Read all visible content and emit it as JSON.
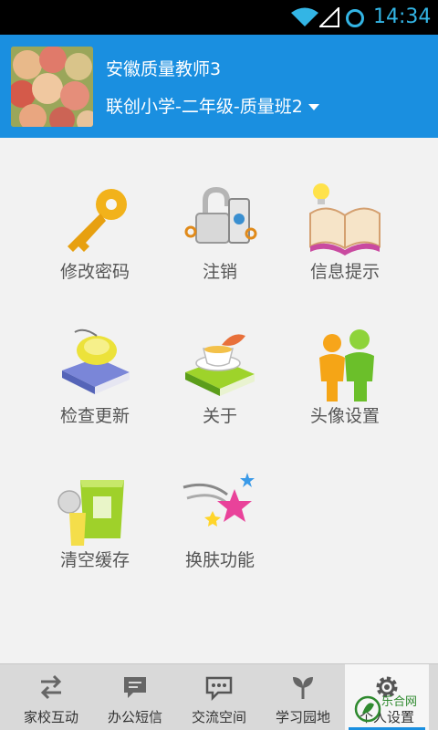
{
  "status_bar": {
    "time": "14:34"
  },
  "header": {
    "user_name": "安徽质量教师3",
    "class_info": "联创小学-二年级-质量班2"
  },
  "menu": [
    {
      "label": "修改密码",
      "icon": "key-icon"
    },
    {
      "label": "注销",
      "icon": "logout-lock-icon"
    },
    {
      "label": "信息提示",
      "icon": "book-bulb-icon"
    },
    {
      "label": "检查更新",
      "icon": "mouse-book-icon"
    },
    {
      "label": "关于",
      "icon": "tea-book-icon"
    },
    {
      "label": "头像设置",
      "icon": "people-icon"
    },
    {
      "label": "清空缓存",
      "icon": "trash-bin-icon"
    },
    {
      "label": "换肤功能",
      "icon": "shooting-stars-icon"
    }
  ],
  "bottom_nav": [
    {
      "label": "家校互动",
      "icon": "swap-arrows-icon"
    },
    {
      "label": "办公短信",
      "icon": "message-icon"
    },
    {
      "label": "交流空间",
      "icon": "chat-dots-icon"
    },
    {
      "label": "学习园地",
      "icon": "sprout-icon"
    },
    {
      "label": "个人设置",
      "icon": "gear-icon",
      "active": true
    }
  ],
  "watermark": {
    "text": "乐合网"
  },
  "colors": {
    "header": "#1a8fe0",
    "status_time": "#33b5e5",
    "background": "#f2f2f2"
  }
}
